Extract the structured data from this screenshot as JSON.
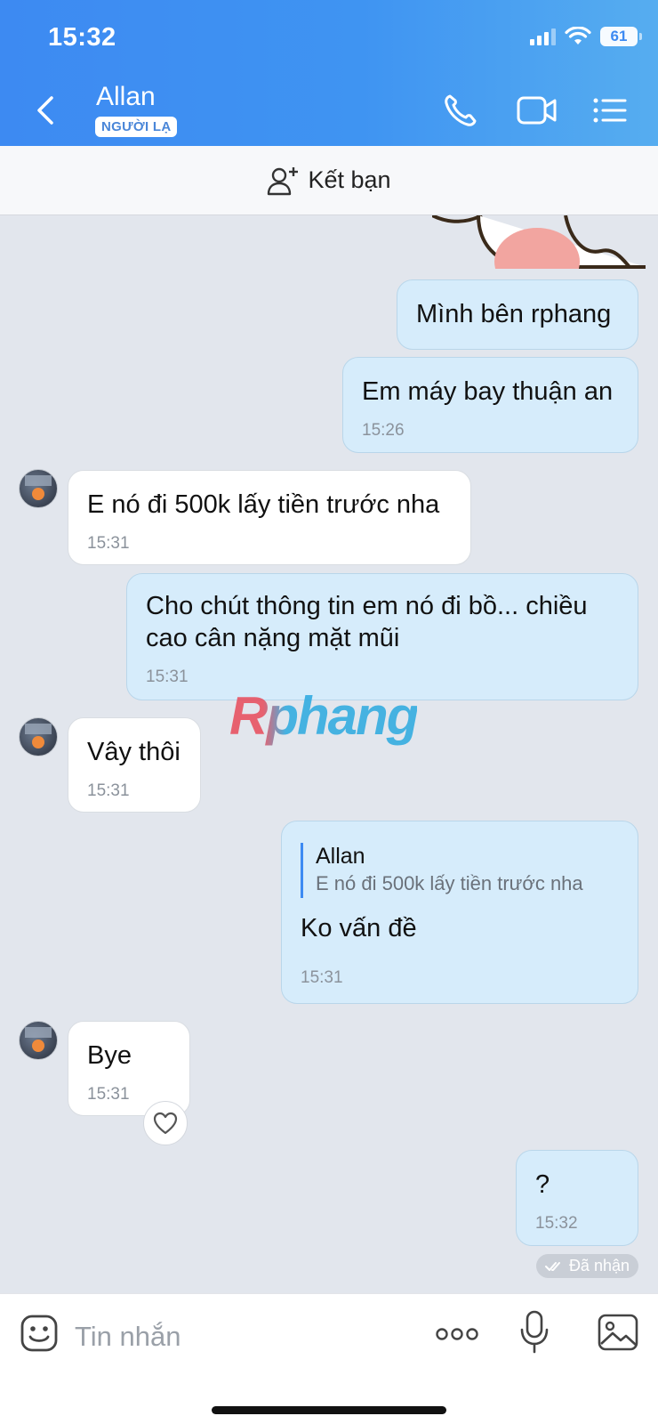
{
  "status_bar": {
    "time": "15:32",
    "battery": "61"
  },
  "header": {
    "contact_name": "Allan",
    "badge": "NGƯỜI LẠ"
  },
  "friend_bar": {
    "label": "Kết bạn"
  },
  "messages": [
    {
      "from": "me",
      "text": "Mình bên rphang",
      "time": ""
    },
    {
      "from": "me",
      "text": "Em máy bay thuận an",
      "time": "15:26"
    },
    {
      "from": "them",
      "text": "E nó đi 500k lấy tiền trước nha",
      "time": "15:31"
    },
    {
      "from": "me",
      "text": "Cho chút thông tin em nó đi bồ... chiều cao cân nặng mặt mũi",
      "time": "15:31"
    },
    {
      "from": "them",
      "text": "Vây thôi",
      "time": "15:31"
    },
    {
      "from": "me",
      "reply_to_name": "Allan",
      "reply_to_text": "E nó đi 500k lấy tiền trước nha",
      "text": "Ko vấn đề",
      "time": "15:31"
    },
    {
      "from": "them",
      "text": "Bye",
      "time": "15:31"
    },
    {
      "from": "me",
      "text": "?",
      "time": "15:32"
    }
  ],
  "receipt": "Đã nhận",
  "watermark": "Rphang",
  "composer": {
    "placeholder": "Tin nhắn"
  },
  "colors": {
    "header_start": "#3d8af2",
    "header_end": "#56adf0",
    "my_bubble": "#d6ecfb",
    "their_bubble": "#ffffff",
    "background": "#e2e6ed"
  }
}
